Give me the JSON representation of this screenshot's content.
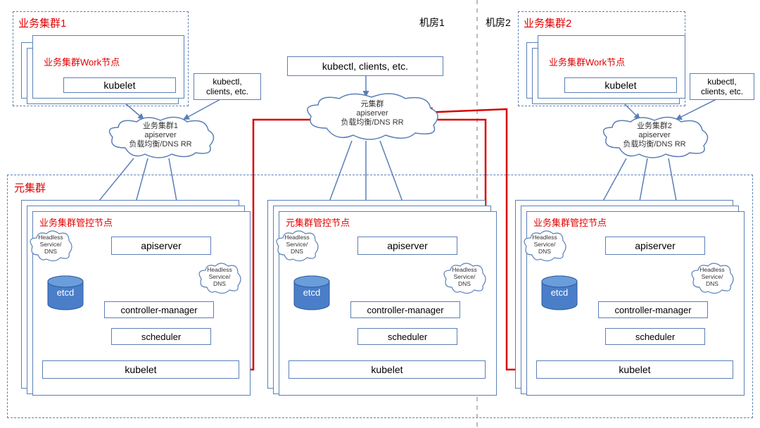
{
  "labels": {
    "room1": "机房1",
    "room2": "机房2",
    "biz_cluster1": "业务集群1",
    "biz_cluster2": "业务集群2",
    "meta_cluster": "元集群",
    "work_node": "业务集群Work节点",
    "kubelet": "kubelet",
    "kubectl_clients": "kubectl, clients, etc.",
    "kubectl_clients_multi": "kubectl,\nclients, etc.",
    "biz_lb1": "业务集群1\napiserver\n负载均衡/DNS RR",
    "biz_lb2": "业务集群2\napiserver\n负载均衡/DNS RR",
    "meta_lb": "元集群\napiserver\n负载均衡/DNS RR",
    "biz_ctrl_node": "业务集群管控节点",
    "meta_ctrl_node": "元集群管控节点",
    "headless": "Headless\nService/\nDNS",
    "apiserver": "apiserver",
    "controller_manager": "controller-manager",
    "scheduler": "scheduler",
    "etcd": "etcd"
  }
}
